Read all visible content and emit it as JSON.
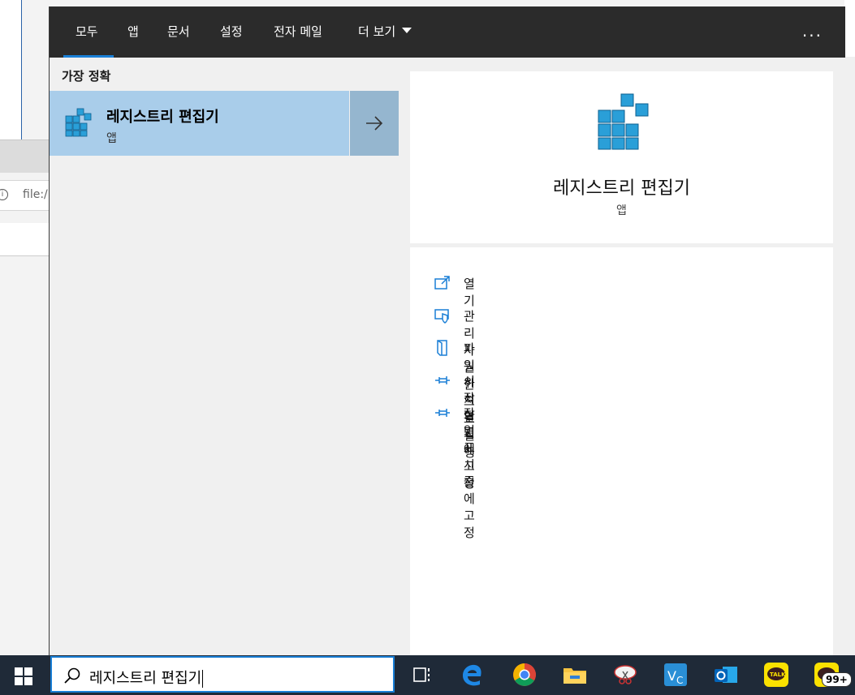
{
  "background": {
    "url_text": "file:/"
  },
  "tabs": [
    {
      "label": "모두"
    },
    {
      "label": "앱"
    },
    {
      "label": "문서"
    },
    {
      "label": "설정"
    },
    {
      "label": "전자 메일"
    },
    {
      "label": "더 보기"
    }
  ],
  "more_label": "...",
  "best_match_label": "가장 정확",
  "best_match": {
    "title": "레지스트리 편집기",
    "subtitle": "앱"
  },
  "detail": {
    "title": "레지스트리 편집기",
    "kind": "앱",
    "actions": [
      {
        "label": "열기",
        "icon": "open-icon"
      },
      {
        "label": "관리자 권한으로 실행",
        "icon": "shield-icon"
      },
      {
        "label": "파일 위치 열기",
        "icon": "file-location-icon"
      },
      {
        "label": "시작 화면에 고정",
        "icon": "pin-icon"
      },
      {
        "label": "작업 표시줄에 고정",
        "icon": "pin-icon"
      }
    ]
  },
  "search": {
    "query": "레지스트리 편집기"
  },
  "taskbar": {
    "badge": "99+"
  },
  "colors": {
    "accent": "#1a7fd6",
    "selected": "#a9cdea",
    "header": "#2b2b2b",
    "taskbar": "#1f2a38"
  }
}
